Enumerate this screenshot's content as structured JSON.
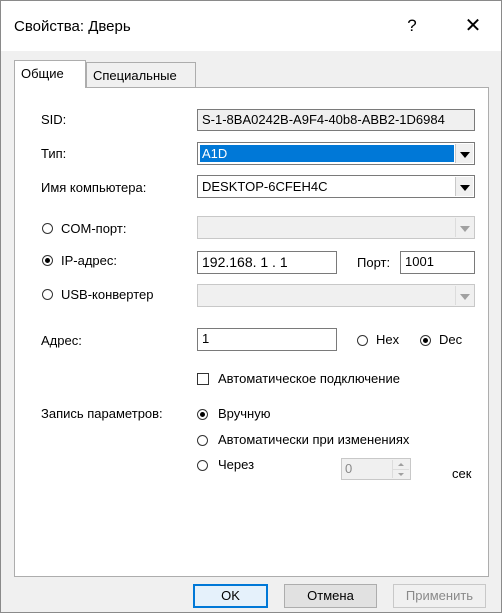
{
  "window": {
    "title": "Свойства: Дверь",
    "help_glyph": "?",
    "close_glyph": "✕"
  },
  "tabs": [
    {
      "label": "Общие",
      "active": true
    },
    {
      "label": "Специальные",
      "active": false
    }
  ],
  "form": {
    "sid_label": "SID:",
    "sid_value": "S-1-8BA0242B-A9F4-40b8-ABB2-1D6984",
    "type_label": "Тип:",
    "type_value": "A1D",
    "computer_label": "Имя компьютера:",
    "computer_value": "DESKTOP-6CFEH4C",
    "com_label": "COM-порт:",
    "ip_label": "IP-адрес:",
    "ip_value": "192.168.  1  .  1",
    "port_label": "Порт:",
    "port_value": "1001",
    "usb_label": "USB-конвертер",
    "connection_selected": "ip",
    "address_label": "Адрес:",
    "address_value": "1",
    "hex_label": "Hex",
    "dec_label": "Dec",
    "number_format": "dec",
    "auto_connect_label": "Автоматическое подключение",
    "auto_connect_checked": false,
    "save_label": "Запись параметров:",
    "save_manual_label": "Вручную",
    "save_auto_label": "Автоматически при изменениях",
    "save_every_label": "Через",
    "save_selected": "manual",
    "interval_value": "0",
    "interval_unit": "сек"
  },
  "buttons": {
    "ok": "OK",
    "cancel": "Отмена",
    "apply": "Применить"
  }
}
